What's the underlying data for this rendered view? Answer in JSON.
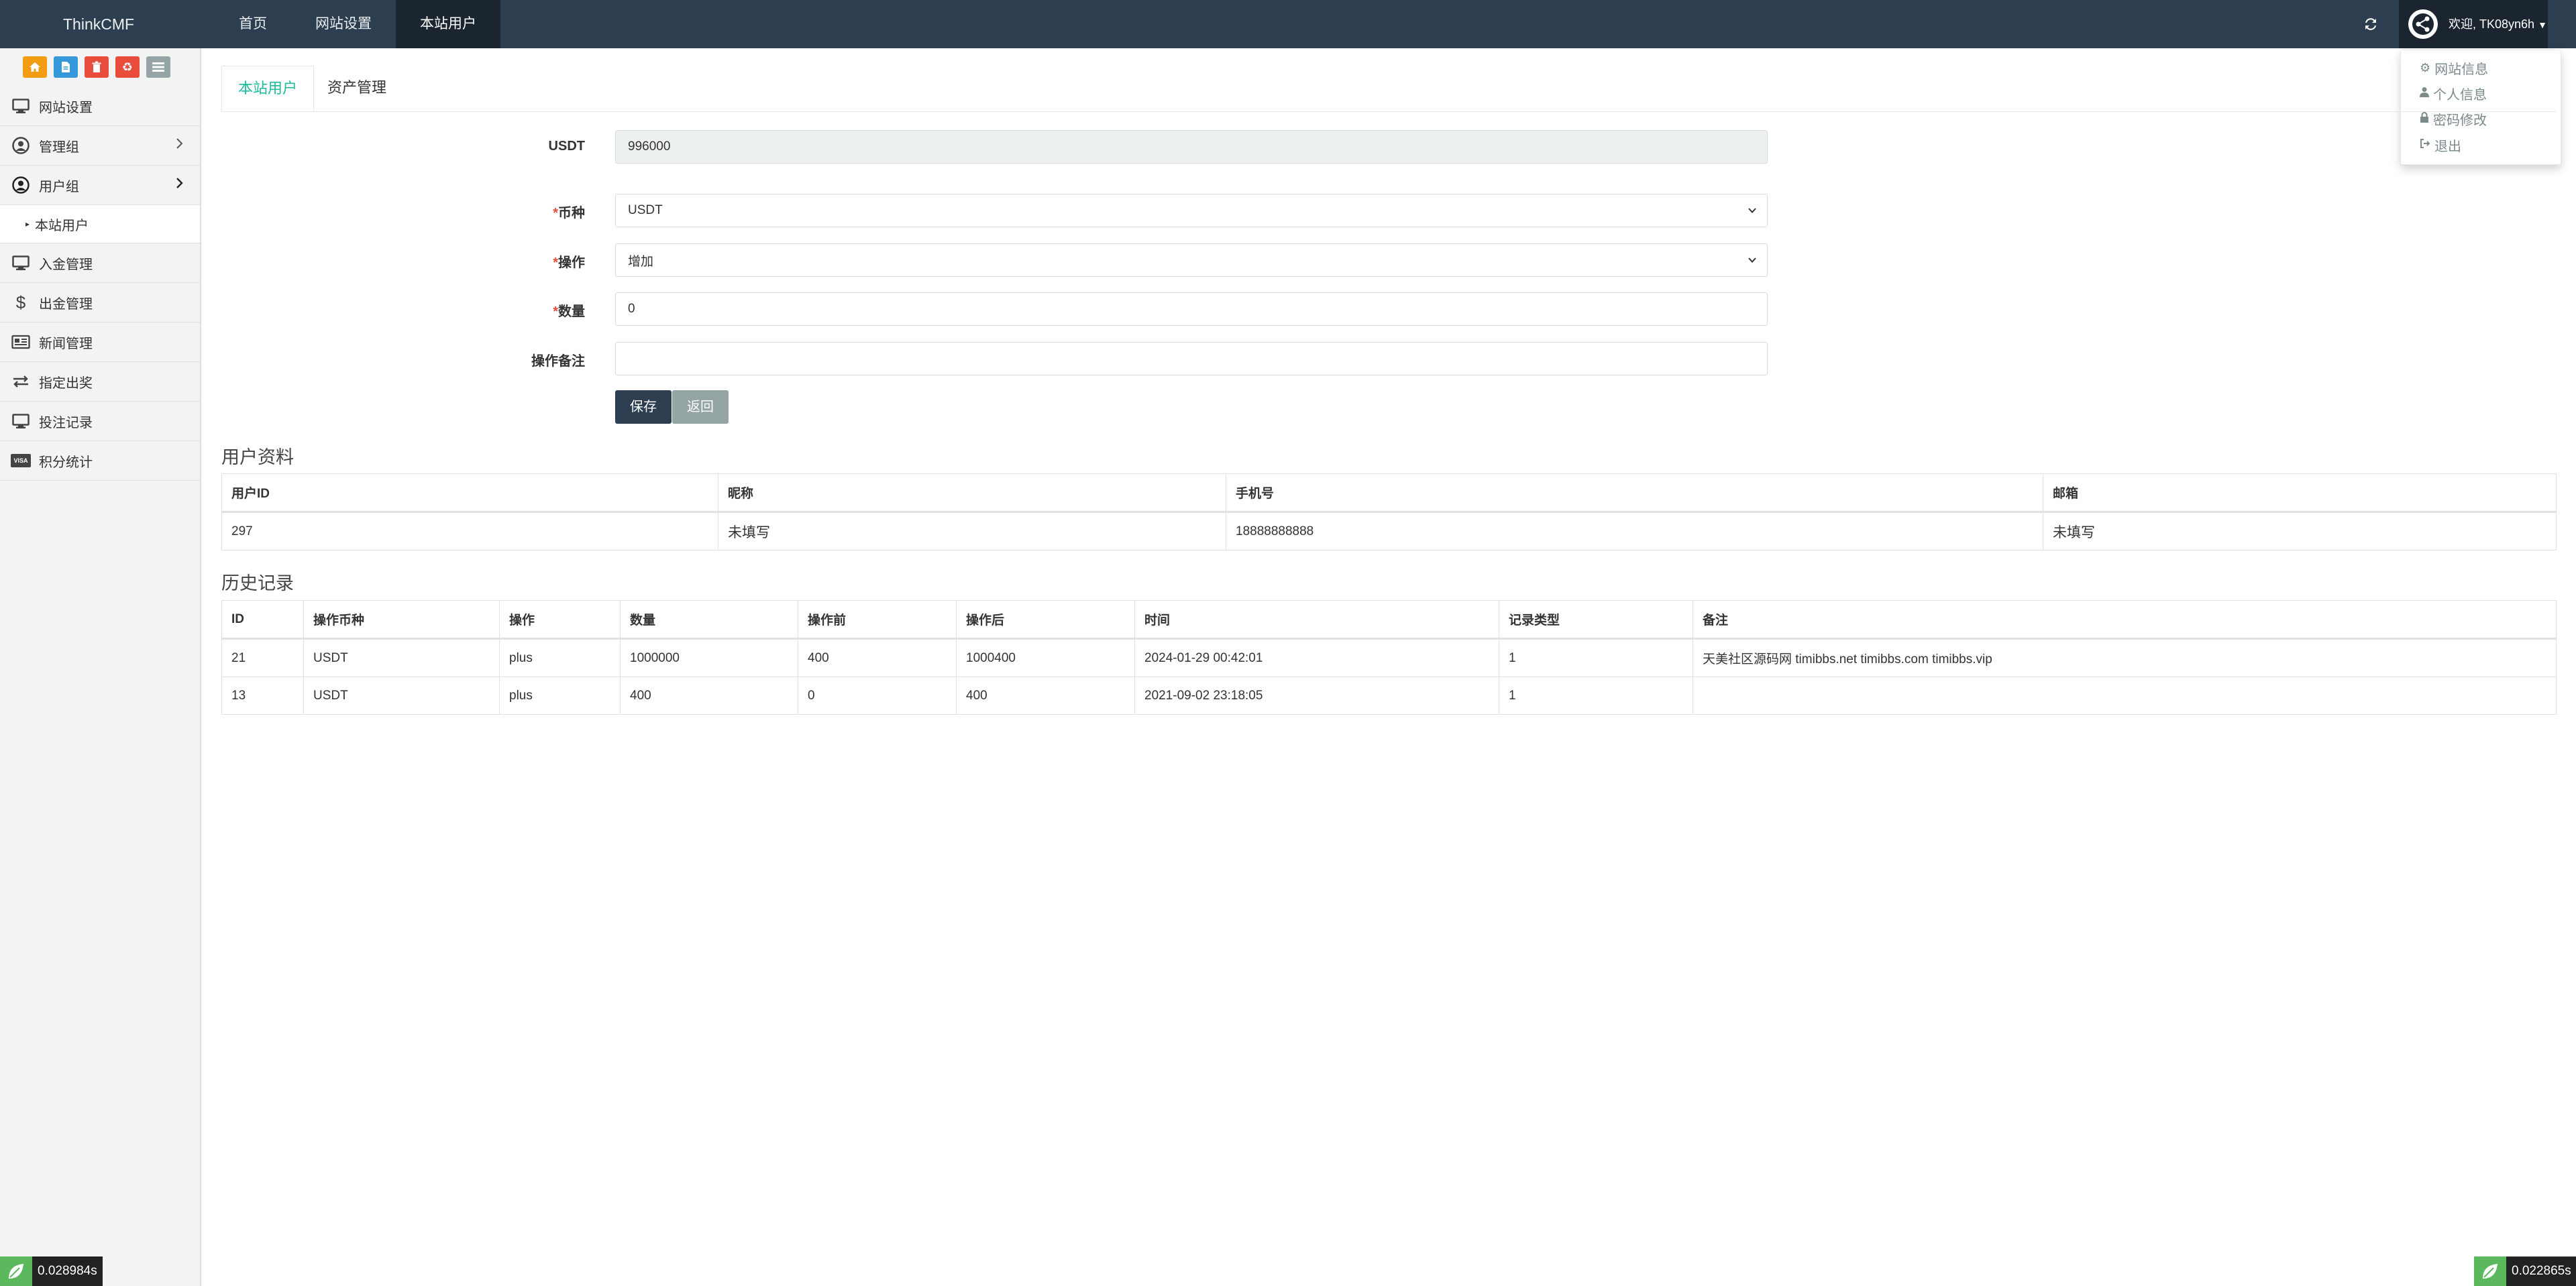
{
  "navbar": {
    "brand": "ThinkCMF",
    "items": [
      {
        "label": "首页",
        "active": false
      },
      {
        "label": "网站设置",
        "active": false
      },
      {
        "label": "本站用户",
        "active": true
      }
    ],
    "user_greeting": "欢迎, TK08yn6h",
    "dropdown": [
      "网站信息",
      "个人信息",
      "密码修改",
      "退出"
    ]
  },
  "sidebar": {
    "shortcuts": [
      {
        "icon": "home-icon",
        "color": "#f39c12"
      },
      {
        "icon": "file-icon",
        "color": "#3498db"
      },
      {
        "icon": "trash-icon",
        "color": "#e74c3c"
      },
      {
        "icon": "recycle-icon",
        "color": "#e74c3c"
      },
      {
        "icon": "list-icon",
        "color": "#95a5a6"
      }
    ],
    "items": [
      {
        "label": "网站设置",
        "icon": "monitor-icon"
      },
      {
        "label": "管理组",
        "icon": "user-circle-icon"
      },
      {
        "label": "用户组",
        "icon": "user-circle-icon"
      },
      {
        "label": "入金管理",
        "icon": "monitor-icon"
      },
      {
        "label": "出金管理",
        "icon": "dollar-icon"
      },
      {
        "label": "新闻管理",
        "icon": "newspaper-icon"
      },
      {
        "label": "指定出奖",
        "icon": "exchange-icon"
      },
      {
        "label": "投注记录",
        "icon": "monitor-icon"
      },
      {
        "label": "积分统计",
        "icon": "visa-icon"
      }
    ],
    "subitem": "本站用户"
  },
  "timers": {
    "left": "0.028984s",
    "right": "0.022865s"
  },
  "tabs": [
    "本站用户",
    "资产管理"
  ],
  "form": {
    "balance_label": "USDT",
    "balance_value": "996000",
    "currency_label": "币种",
    "currency_value": "USDT",
    "operation_label": "操作",
    "operation_value": "增加",
    "amount_label": "数量",
    "amount_value": "0",
    "remark_label": "操作备注",
    "remark_value": "",
    "save_label": "保存",
    "back_label": "返回"
  },
  "profile": {
    "title": "用户资料",
    "headers": [
      "用户ID",
      "昵称",
      "手机号",
      "邮箱"
    ],
    "row": [
      "297",
      "未填写",
      "18888888888",
      "未填写"
    ]
  },
  "history": {
    "title": "历史记录",
    "headers": [
      "ID",
      "操作币种",
      "操作",
      "数量",
      "操作前",
      "操作后",
      "时间",
      "记录类型",
      "备注"
    ],
    "rows": [
      [
        "21",
        "USDT",
        "plus",
        "1000000",
        "400",
        "1000400",
        "2024-01-29 00:42:01",
        "1",
        "天美社区源码网 timibbs.net timibbs.com timibbs.vip"
      ],
      [
        "13",
        "USDT",
        "plus",
        "400",
        "0",
        "400",
        "2021-09-02 23:18:05",
        "1",
        ""
      ]
    ]
  }
}
